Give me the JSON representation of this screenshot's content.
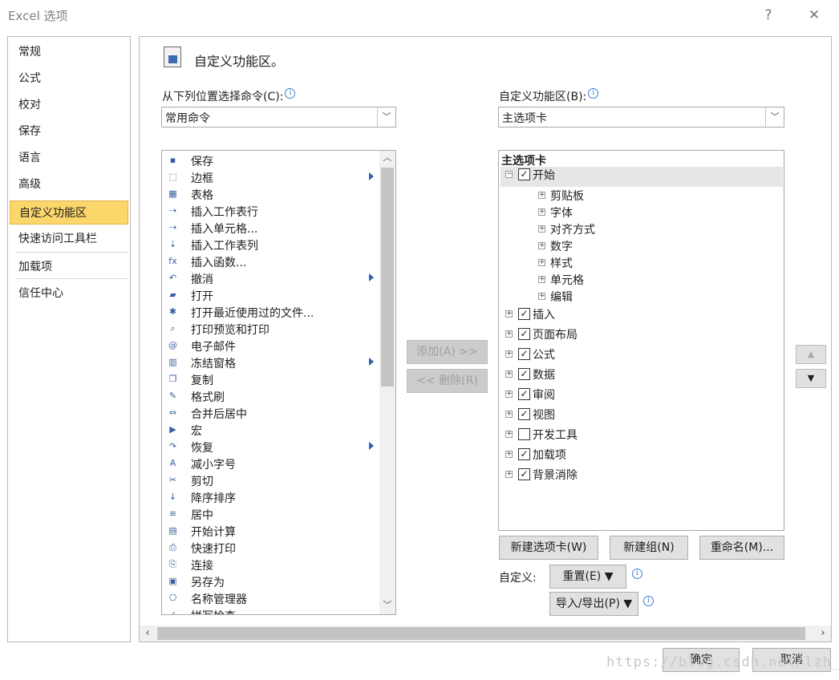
{
  "window": {
    "title": "Excel 选项",
    "help": "?",
    "close": "✕"
  },
  "nav": {
    "items": [
      "常规",
      "公式",
      "校对",
      "保存",
      "语言",
      "高级",
      "自定义功能区",
      "快速访问工具栏",
      "加载项",
      "信任中心"
    ],
    "selected": "自定义功能区"
  },
  "heading": "自定义功能区。",
  "left": {
    "label": "从下列位置选择命令(C):",
    "combo_value": "常用命令",
    "commands": [
      {
        "label": "保存",
        "icon": "save-icon",
        "glyph": "▪"
      },
      {
        "label": "边框",
        "icon": "borders-icon",
        "glyph": "⬚",
        "sub": true
      },
      {
        "label": "表格",
        "icon": "table-icon",
        "glyph": "▦"
      },
      {
        "label": "插入工作表行",
        "icon": "insert-rows-icon",
        "glyph": "⇢"
      },
      {
        "label": "插入单元格...",
        "icon": "insert-cells-icon",
        "glyph": "⇢"
      },
      {
        "label": "插入工作表列",
        "icon": "insert-columns-icon",
        "glyph": "⇣"
      },
      {
        "label": "插入函数...",
        "icon": "function-icon",
        "glyph": "fx"
      },
      {
        "label": "撤消",
        "icon": "undo-icon",
        "glyph": "↶",
        "sub": true
      },
      {
        "label": "打开",
        "icon": "open-folder-icon",
        "glyph": "▰"
      },
      {
        "label": "打开最近使用过的文件...",
        "icon": "recent-files-icon",
        "glyph": "✱"
      },
      {
        "label": "打印预览和打印",
        "icon": "print-preview-icon",
        "glyph": "⌕"
      },
      {
        "label": "电子邮件",
        "icon": "email-icon",
        "glyph": "@"
      },
      {
        "label": "冻结窗格",
        "icon": "freeze-panes-icon",
        "glyph": "▥",
        "sub": true
      },
      {
        "label": "复制",
        "icon": "copy-icon",
        "glyph": "❐"
      },
      {
        "label": "格式刷",
        "icon": "format-painter-icon",
        "glyph": "✎"
      },
      {
        "label": "合并后居中",
        "icon": "merge-center-icon",
        "glyph": "⇔"
      },
      {
        "label": "宏",
        "icon": "macro-icon",
        "glyph": "▶"
      },
      {
        "label": "恢复",
        "icon": "redo-icon",
        "glyph": "↷",
        "sub": true
      },
      {
        "label": "减小字号",
        "icon": "decrease-font-icon",
        "glyph": "A"
      },
      {
        "label": "剪切",
        "icon": "cut-icon",
        "glyph": "✂"
      },
      {
        "label": "降序排序",
        "icon": "sort-descending-icon",
        "glyph": "↓"
      },
      {
        "label": "居中",
        "icon": "center-align-icon",
        "glyph": "≡"
      },
      {
        "label": "开始计算",
        "icon": "calculate-icon",
        "glyph": "▤"
      },
      {
        "label": "快速打印",
        "icon": "quick-print-icon",
        "glyph": "⎙"
      },
      {
        "label": "连接",
        "icon": "connections-icon",
        "glyph": "⎘"
      },
      {
        "label": "另存为",
        "icon": "save-as-icon",
        "glyph": "▣"
      },
      {
        "label": "名称管理器",
        "icon": "name-manager-icon",
        "glyph": "⎔"
      },
      {
        "label": "拼写检查",
        "icon": "spelling-icon",
        "glyph": "✓"
      }
    ]
  },
  "add_button": "添加(A) >>",
  "remove_button": "<< 删除(R)",
  "right": {
    "label": "自定义功能区(B):",
    "combo_value": "主选项卡",
    "tree_header": "主选项卡",
    "tree": [
      {
        "label": "开始",
        "checked": true,
        "expanded": true,
        "children": [
          "剪贴板",
          "字体",
          "对齐方式",
          "数字",
          "样式",
          "单元格",
          "编辑"
        ]
      },
      {
        "label": "插入",
        "checked": true
      },
      {
        "label": "页面布局",
        "checked": true
      },
      {
        "label": "公式",
        "checked": true
      },
      {
        "label": "数据",
        "checked": true
      },
      {
        "label": "审阅",
        "checked": true
      },
      {
        "label": "视图",
        "checked": true
      },
      {
        "label": "开发工具",
        "checked": false
      },
      {
        "label": "加载项",
        "checked": true
      },
      {
        "label": "背景消除",
        "checked": true
      }
    ],
    "new_tab": "新建选项卡(W)",
    "new_group": "新建组(N)",
    "rename": "重命名(M)...",
    "customize_label": "自定义:",
    "reset": "重置(E) ▼",
    "import_export": "导入/导出(P) ▼"
  },
  "footer": {
    "ok": "确定",
    "cancel": "取消",
    "watermark": "https://blog.csdn.net/lzh_ash"
  }
}
